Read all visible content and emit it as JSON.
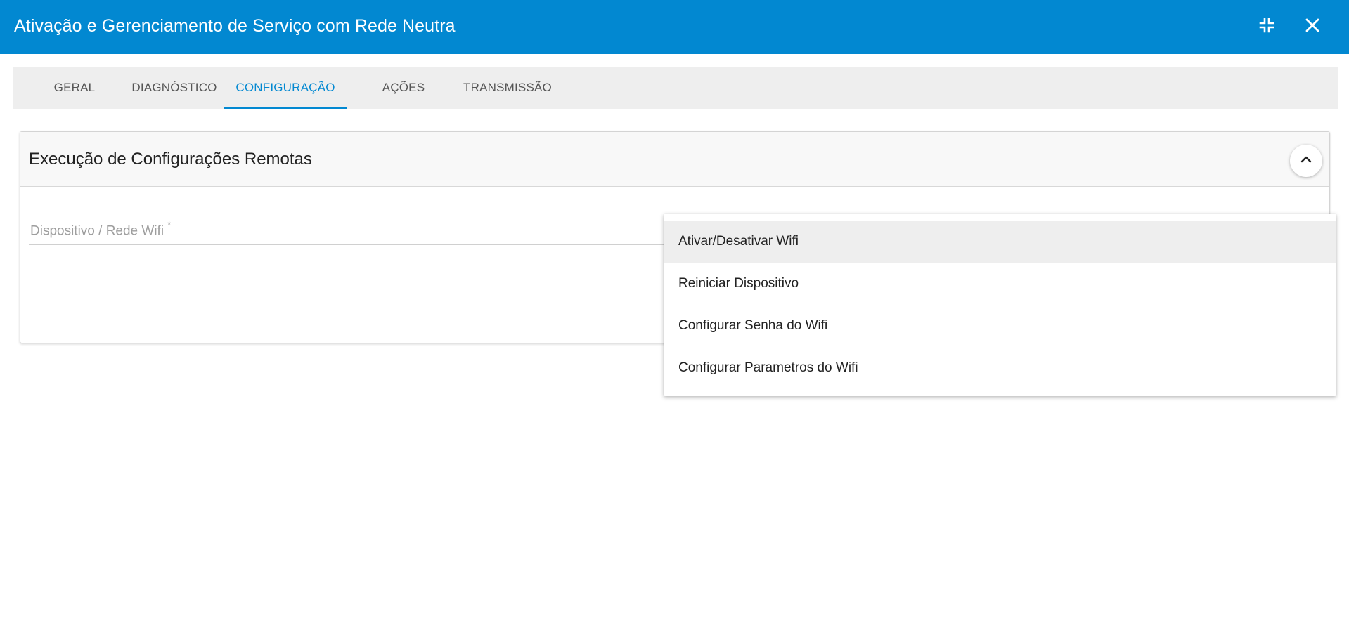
{
  "window": {
    "title": "Ativação e Gerenciamento de Serviço com Rede Neutra",
    "accent_color": "#0288d1",
    "buttons": [
      {
        "icon": "minimize-icon"
      },
      {
        "icon": "close-icon"
      }
    ]
  },
  "tabs": [
    {
      "label": "GERAL",
      "active": false
    },
    {
      "label": "DIAGNÓSTICO",
      "active": false
    },
    {
      "label": "CONFIGURAÇÃO",
      "active": true
    },
    {
      "label": "AÇÕES",
      "active": false
    },
    {
      "label": "TRANSMISSÃO",
      "active": false
    }
  ],
  "panel": {
    "title": "Execução de Configurações Remotas",
    "collapse_icon": "chevron-up-icon",
    "field": {
      "label": "Dispositivo / Rede Wifi",
      "required_marker": "*",
      "value": ""
    }
  },
  "dropdown": {
    "options": [
      {
        "label": "Ativar/Desativar Wifi",
        "highlighted": true
      },
      {
        "label": "Reiniciar Dispositivo",
        "highlighted": false
      },
      {
        "label": "Configurar Senha do Wifi",
        "highlighted": false
      },
      {
        "label": "Configurar Parametros do Wifi",
        "highlighted": false
      }
    ]
  }
}
